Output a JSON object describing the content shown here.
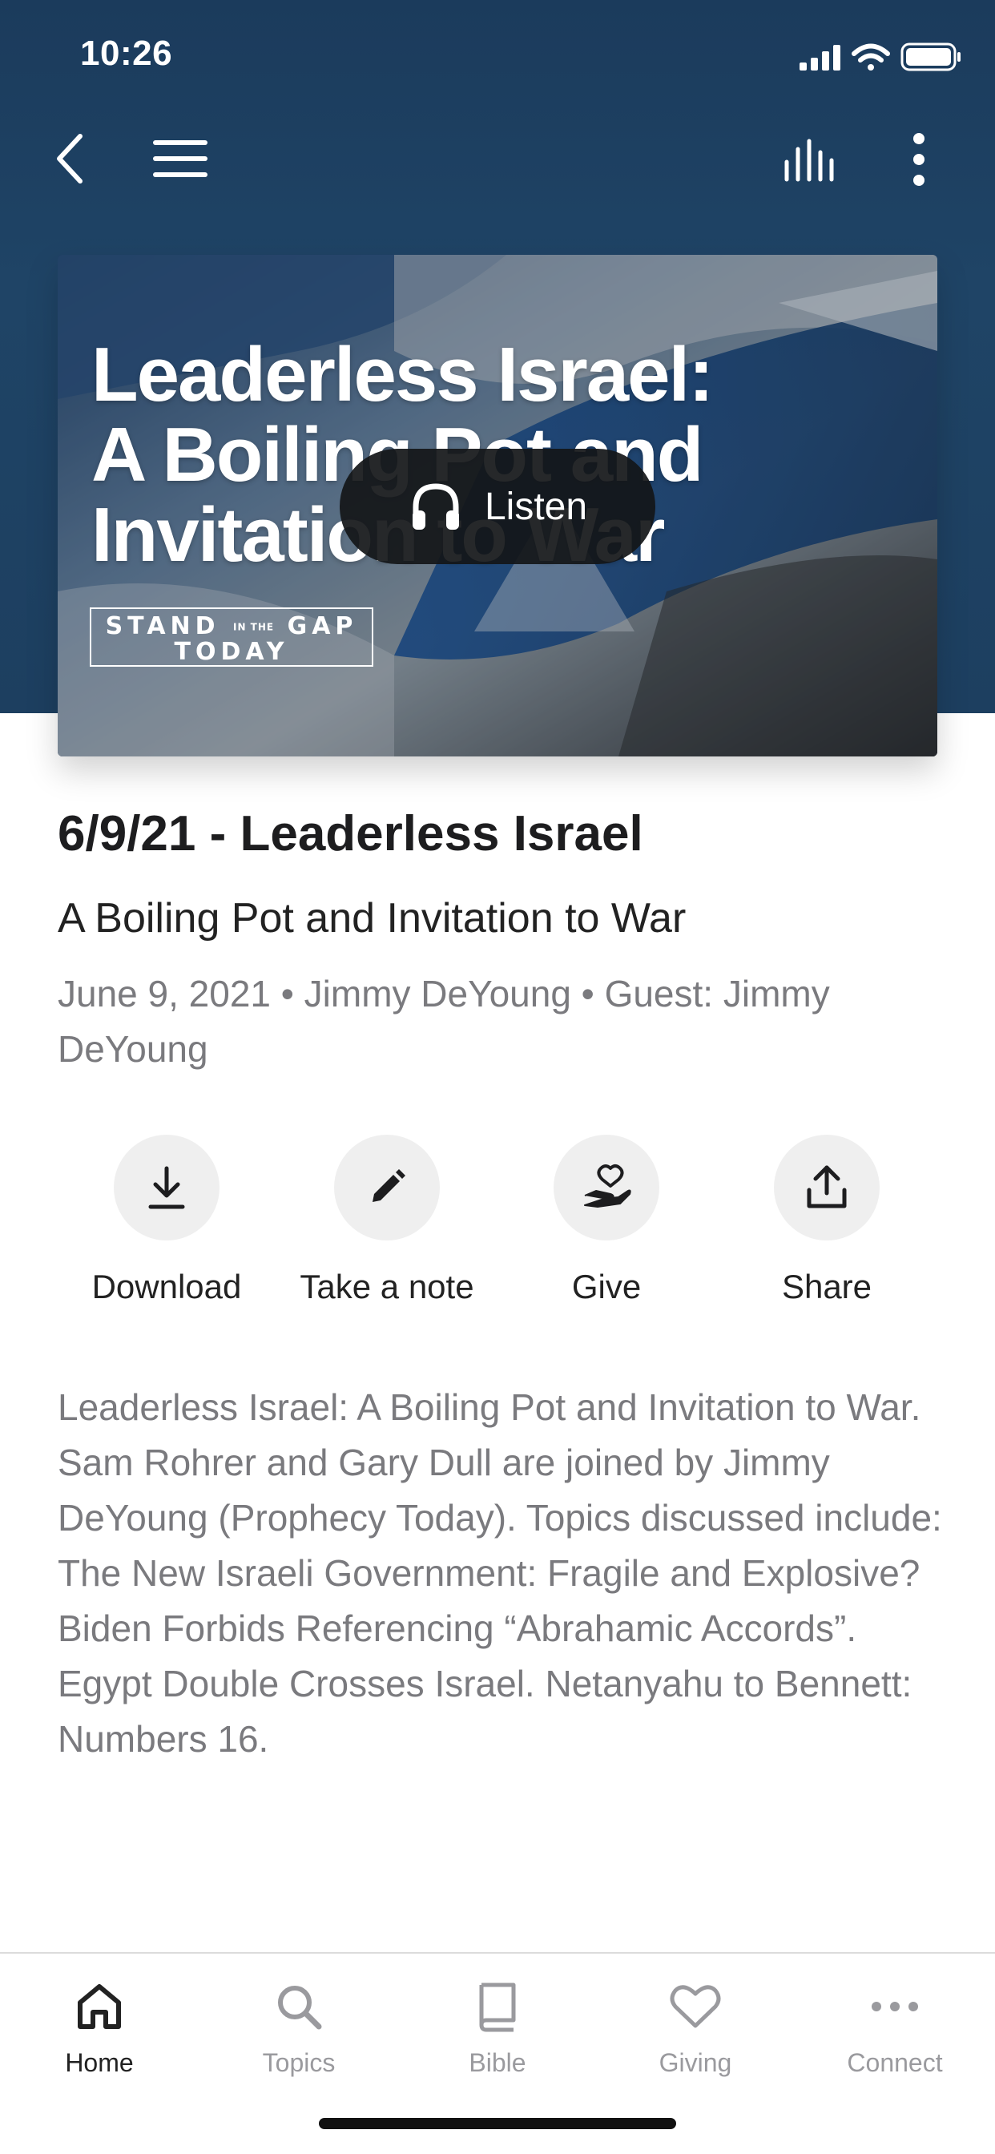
{
  "status_bar": {
    "time": "10:26"
  },
  "top_nav": {
    "icons": [
      "back-chevron-icon",
      "menu-icon",
      "audio-levels-icon",
      "more-vertical-icon"
    ]
  },
  "artwork": {
    "title_lines": [
      "Leaderless Israel:",
      "A Boiling Pot and",
      "Invitation to War"
    ],
    "brand_line1_a": "STAND",
    "brand_line1_small": "IN THE",
    "brand_line1_b": "GAP",
    "brand_line2": "TODAY",
    "listen_label": "Listen"
  },
  "episode": {
    "title": "6/9/21 - Leaderless Israel",
    "subtitle": "A Boiling Pot and Invitation to War",
    "meta": "June 9, 2021 • Jimmy DeYoung • Guest: Jimmy DeYoung",
    "description": "Leaderless Israel: A Boiling Pot and Invitation to War. Sam Rohrer and Gary Dull are joined by Jimmy DeYoung (Prophecy Today). Topics discussed include: The New Israeli Government: Fragile and Explosive? Biden Forbids Referencing “Abrahamic Accords”. Egypt Double Crosses Israel. Netanyahu to Bennett: Numbers 16."
  },
  "actions": [
    {
      "label": "Download",
      "icon": "download-icon"
    },
    {
      "label": "Take a note",
      "icon": "pencil-icon"
    },
    {
      "label": "Give",
      "icon": "give-heart-hand-icon"
    },
    {
      "label": "Share",
      "icon": "share-icon"
    }
  ],
  "tabs": [
    {
      "label": "Home",
      "icon": "home-icon",
      "active": true
    },
    {
      "label": "Topics",
      "icon": "search-icon",
      "active": false
    },
    {
      "label": "Bible",
      "icon": "book-icon",
      "active": false
    },
    {
      "label": "Giving",
      "icon": "heart-icon",
      "active": false
    },
    {
      "label": "Connect",
      "icon": "more-horizontal-icon",
      "active": false
    }
  ],
  "colors": {
    "header_bg": "#1f4466",
    "text_primary": "#1d1d1f",
    "text_secondary": "#7a7a7e",
    "action_circle": "#efefef",
    "tab_inactive": "#9a9a9e"
  }
}
